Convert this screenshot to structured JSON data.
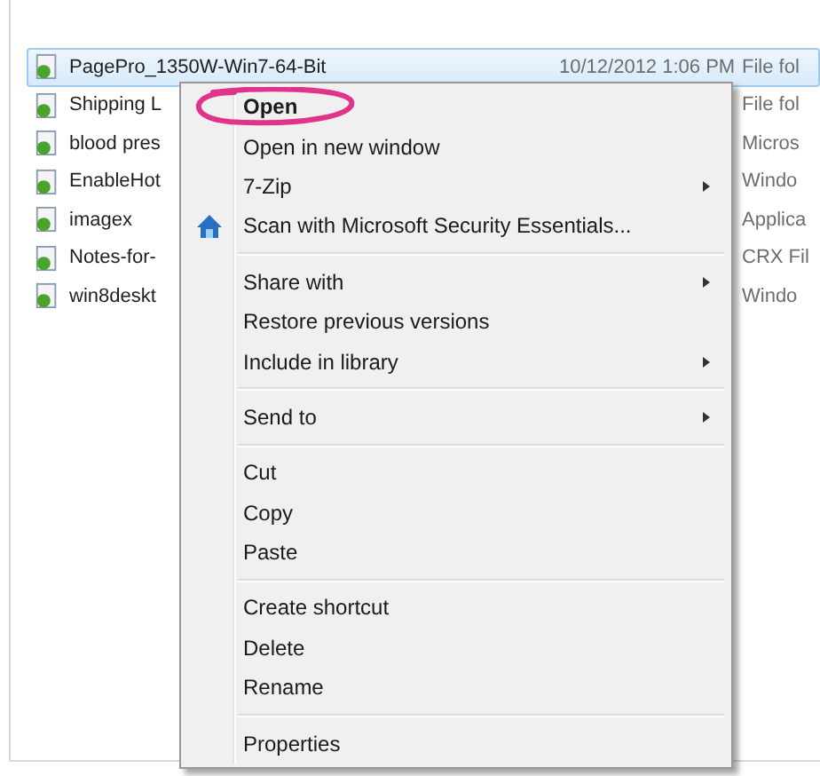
{
  "files": [
    {
      "name": "PagePro_1350W-Win7-64-Bit",
      "date": "10/12/2012 1:06 PM",
      "type": "File fol",
      "selected": true
    },
    {
      "name": "Shipping L",
      "type": "File fol",
      "selected": false
    },
    {
      "name": "blood pres",
      "type": "Micros",
      "selected": false
    },
    {
      "name": "EnableHot",
      "type": "Windo",
      "selected": false
    },
    {
      "name": "imagex",
      "type": "Applica",
      "selected": false
    },
    {
      "name": "Notes-for-",
      "type": "CRX Fil",
      "selected": false
    },
    {
      "name": "win8deskt",
      "type": "Windo",
      "selected": false
    }
  ],
  "context_menu": [
    {
      "kind": "item",
      "label": "Open",
      "default": true,
      "submenu": false
    },
    {
      "kind": "item",
      "label": "Open in new window",
      "default": false,
      "submenu": false
    },
    {
      "kind": "item",
      "label": "7-Zip",
      "default": false,
      "submenu": true
    },
    {
      "kind": "icon_item",
      "label": "Scan with Microsoft Security Essentials...",
      "default": false,
      "submenu": false
    },
    {
      "kind": "separator"
    },
    {
      "kind": "item",
      "label": "Share with",
      "default": false,
      "submenu": true
    },
    {
      "kind": "item",
      "label": "Restore previous versions",
      "default": false,
      "submenu": false
    },
    {
      "kind": "item",
      "label": "Include in library",
      "default": false,
      "submenu": true
    },
    {
      "kind": "separator"
    },
    {
      "kind": "item",
      "label": "Send to",
      "default": false,
      "submenu": true
    },
    {
      "kind": "separator"
    },
    {
      "kind": "item",
      "label": "Cut",
      "default": false,
      "submenu": false
    },
    {
      "kind": "item",
      "label": "Copy",
      "default": false,
      "submenu": false
    },
    {
      "kind": "item",
      "label": "Paste",
      "default": false,
      "submenu": false
    },
    {
      "kind": "separator"
    },
    {
      "kind": "item",
      "label": "Create shortcut",
      "default": false,
      "submenu": false
    },
    {
      "kind": "item",
      "label": "Delete",
      "default": false,
      "submenu": false
    },
    {
      "kind": "item",
      "label": "Rename",
      "default": false,
      "submenu": false
    },
    {
      "kind": "separator"
    },
    {
      "kind": "item",
      "label": "Properties",
      "default": false,
      "submenu": false
    }
  ]
}
